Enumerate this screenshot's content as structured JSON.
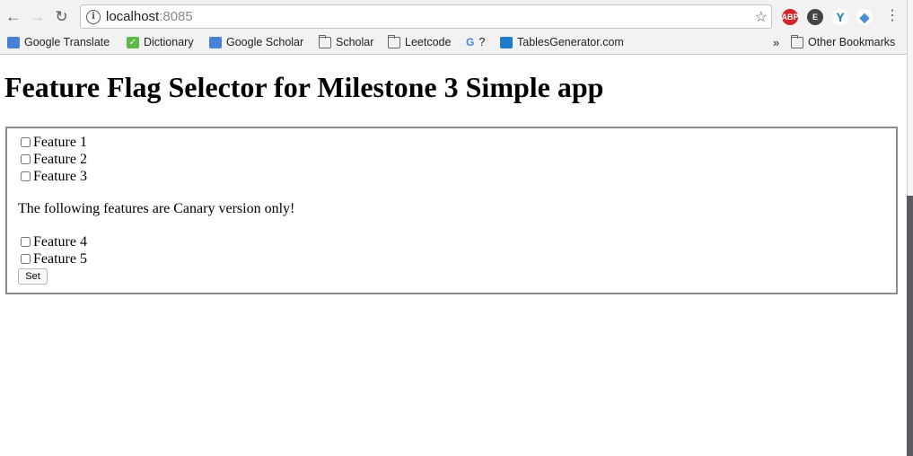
{
  "browser": {
    "url_host": "localhost",
    "url_port": ":8085",
    "extensions": [
      "adblock-plus",
      "evernote",
      "vue-devtools",
      "diamond"
    ],
    "bookmarks": [
      {
        "label": "Google Translate",
        "icon": "google-translate-icon"
      },
      {
        "label": "Dictionary",
        "icon": "checkmark-icon"
      },
      {
        "label": "Google Scholar",
        "icon": "google-scholar-icon"
      },
      {
        "label": "Scholar",
        "icon": "folder-icon"
      },
      {
        "label": "Leetcode",
        "icon": "folder-icon"
      },
      {
        "label": "?",
        "icon": "google-g-icon"
      },
      {
        "label": "TablesGenerator.com",
        "icon": "tables-generator-icon"
      }
    ],
    "overflow": "»",
    "other_bookmarks": "Other Bookmarks"
  },
  "page": {
    "title": "Feature Flag Selector for Milestone 3 Simple app",
    "features": [
      {
        "label": "Feature 1",
        "checked": false
      },
      {
        "label": "Feature 2",
        "checked": false
      },
      {
        "label": "Feature 3",
        "checked": false
      }
    ],
    "canary_note": "The following features are Canary version only!",
    "canary_features": [
      {
        "label": "Feature 4",
        "checked": false
      },
      {
        "label": "Feature 5",
        "checked": false
      }
    ],
    "set_button": "Set"
  },
  "colors": {
    "abp": "#d5222b",
    "evernote": "#333333",
    "vue": "#1d7fb8",
    "diamond": "#4a90d9",
    "dictionary": "#5fb84a",
    "tables": "#1e7bd1"
  }
}
